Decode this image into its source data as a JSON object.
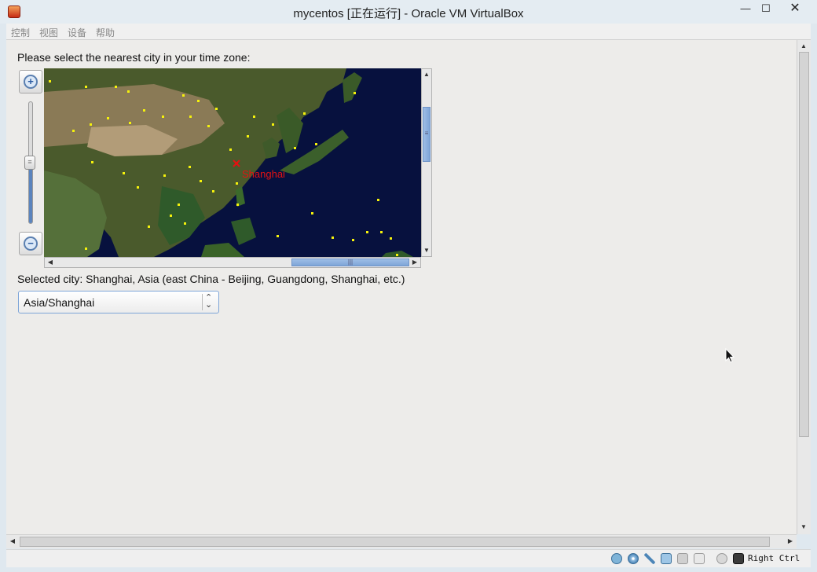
{
  "window": {
    "title": "mycentos [正在运行] - Oracle VM VirtualBox",
    "minimize_glyph": "—",
    "maximize_glyph": "☐",
    "close_glyph": "✕"
  },
  "menu": [
    "控制",
    "视图",
    "设备",
    "帮助"
  ],
  "timezone": {
    "prompt": "Please select the nearest city in your time zone:",
    "map_city_label": "Shanghai",
    "selected_city_text": "Selected city: Shanghai, Asia (east China - Beijing, Guangdong, Shanghai, etc.)",
    "dropdown_value": "Asia/Shanghai",
    "zoom_level_fraction": 0.55
  },
  "statusbar": {
    "host_key": "Right Ctrl",
    "icons": [
      "hard-disk-icon",
      "optical-drive-icon",
      "usb-icon",
      "network-icon",
      "shared-folders-icon",
      "display-icon",
      "mouse-integration-icon",
      "keyboard-capture-icon"
    ]
  },
  "colors": {
    "ocean": "#07113e",
    "city_dot": "#f5f20c",
    "selected_city": "#e31212",
    "scroll_thumb": "#7ea5d8"
  }
}
